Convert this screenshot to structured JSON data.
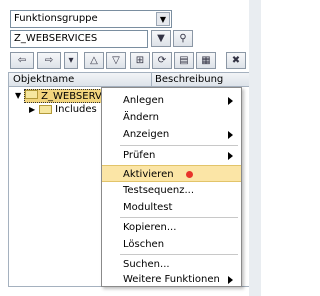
{
  "selector": {
    "value": "Funktionsgruppe",
    "object_name": "Z_WEBSERVICES"
  },
  "tree": {
    "col1": "Objektname",
    "col2": "Beschreibung",
    "nodes": [
      {
        "label": "Z_WEBSERVIC",
        "expanded": true
      },
      {
        "label": "Includes",
        "expanded": false
      }
    ]
  },
  "context_menu": {
    "items": [
      {
        "label": "Anlegen"
      },
      {
        "label": "Ändern"
      },
      {
        "label": "Anzeigen"
      },
      {
        "label": "Prüfen"
      },
      {
        "label": "Aktivieren"
      },
      {
        "label": "Testsequenz..."
      },
      {
        "label": "Modultest"
      },
      {
        "label": "Kopieren..."
      },
      {
        "label": "Löschen"
      },
      {
        "label": "Suchen..."
      },
      {
        "label": "Weitere Funktionen"
      }
    ]
  },
  "colors": {
    "highlight": "#fbe5a6",
    "dot": "#e8342b"
  }
}
